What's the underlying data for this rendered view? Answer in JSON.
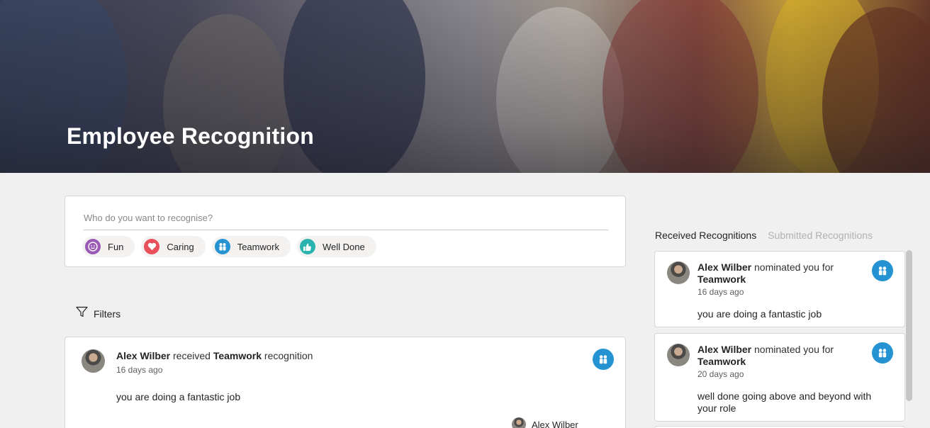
{
  "hero": {
    "title": "Employee Recognition"
  },
  "compose": {
    "placeholder": "Who do you want to recognise?",
    "chips": [
      {
        "label": "Fun",
        "icon": "smiley-icon",
        "color": "#9b59b6"
      },
      {
        "label": "Caring",
        "icon": "heart-icon",
        "color": "#e8505b"
      },
      {
        "label": "Teamwork",
        "icon": "team-icon",
        "color": "#2592d2"
      },
      {
        "label": "Well Done",
        "icon": "thumbs-up-icon",
        "color": "#2bb3b0"
      }
    ]
  },
  "filters": {
    "label": "Filters"
  },
  "feed": [
    {
      "name": "Alex Wilber",
      "verb": " received ",
      "category": "Teamwork",
      "suffix": " recognition",
      "time": "16 days ago",
      "message": "you are doing a fantastic job",
      "author": "Alex Wilber"
    }
  ],
  "panel": {
    "tabs": [
      {
        "label": "Received Recognitions",
        "active": true
      },
      {
        "label": "Submitted Recognitions",
        "active": false
      }
    ],
    "cards": [
      {
        "name": "Alex Wilber",
        "verb": " nominated you for ",
        "category": "Teamwork",
        "time": "16 days ago",
        "message": "you are doing a fantastic job"
      },
      {
        "name": "Alex Wilber",
        "verb": " nominated you for ",
        "category": "Teamwork",
        "time": "20 days ago",
        "message": "well done going above and beyond with your role"
      }
    ]
  },
  "colors": {
    "accent": "#2592d2",
    "background": "#f0f0f0"
  }
}
